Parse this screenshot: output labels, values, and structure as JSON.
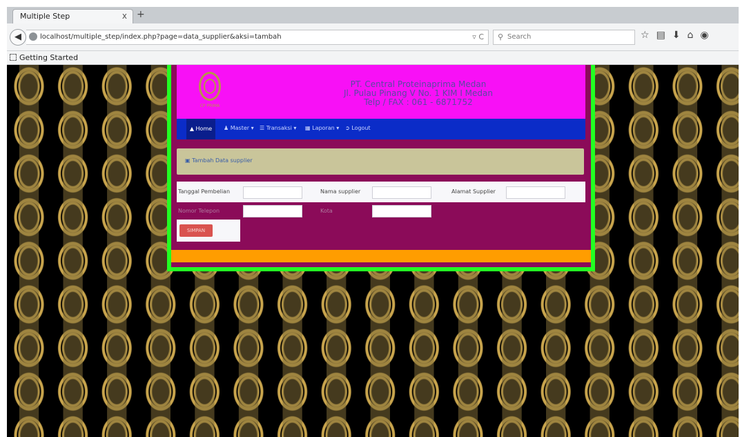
{
  "browser": {
    "tab_title": "Multiple Step",
    "tab_close": "x",
    "new_tab": "+",
    "url": "localhost/multiple_step/index.php?page=data_supplier&aksi=tambah",
    "url_tools": "▿ C",
    "search_placeholder": "Search",
    "bookmark_label": "Getting Started"
  },
  "app": {
    "logo_caption": "CP PRIMA",
    "company": {
      "name": "PT. Central Proteinaprima Medan",
      "address": "Jl. Pulau Pinang V No. 1 KIM I Medan",
      "phone": "Telp / FAX : 061 - 6871752"
    },
    "menu": [
      {
        "label": "Home"
      },
      {
        "label": "Master ▾"
      },
      {
        "label": "Transaksi ▾"
      },
      {
        "label": "Laporan ▾"
      },
      {
        "label": "Logout"
      }
    ],
    "panel_title": "Tambah Data supplier",
    "form": {
      "fields_row1": [
        {
          "label": "Tanggal Pembelian",
          "value": ""
        },
        {
          "label": "Nama supplier",
          "value": ""
        },
        {
          "label": "Alamat Supplier",
          "value": ""
        }
      ],
      "fields_row2": [
        {
          "label": "Nomor Telepon",
          "value": ""
        },
        {
          "label": "Kota",
          "value": ""
        }
      ],
      "submit_label": "SIMPAN"
    }
  },
  "colors": {
    "header_bg": "#f810f6",
    "menubar_bg": "#0b2cc8",
    "page_bg": "#8b0b59",
    "border": "#22ff22",
    "footer": "#ff9d00",
    "panel_heading": "#c9c59a",
    "button": "#d9534f"
  }
}
